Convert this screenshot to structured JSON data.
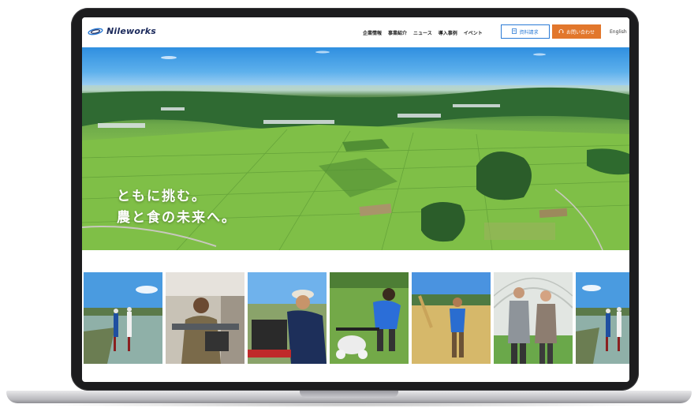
{
  "brand": {
    "logo_text": "Nileworks"
  },
  "nav": {
    "items": [
      {
        "label": "企業情報"
      },
      {
        "label": "事業紹介"
      },
      {
        "label": "ニュース"
      },
      {
        "label": "導入事例"
      },
      {
        "label": "イベント"
      }
    ],
    "docs_button": "資料請求",
    "contact_button": "お問い合わせ",
    "language": "English"
  },
  "hero": {
    "tagline_line1": "ともに挑む。",
    "tagline_line2": "農と食の未来へ。"
  },
  "photos": [
    {
      "icon": "drone-field-photo"
    },
    {
      "icon": "mechanic-photo"
    },
    {
      "icon": "engineer-photo"
    },
    {
      "icon": "drone-woman-photo"
    },
    {
      "icon": "wheat-farmer-photo"
    },
    {
      "icon": "greenhouse-couple-photo"
    },
    {
      "icon": "drone-field-photo-2"
    }
  ],
  "colors": {
    "brand_navy": "#1b2a5c",
    "accent_blue": "#2b7bd6",
    "accent_orange": "#e2772c"
  }
}
